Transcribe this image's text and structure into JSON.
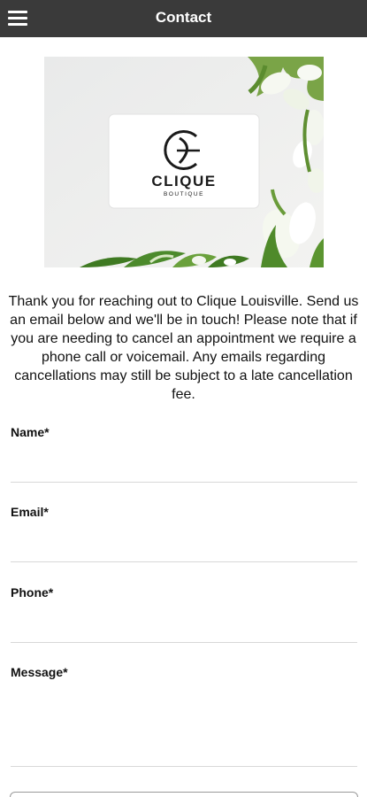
{
  "header": {
    "title": "Contact"
  },
  "hero": {
    "brand_name": "CLIQUE",
    "brand_sub": "BOUTIQUE",
    "monogram": "C"
  },
  "intro": {
    "text": "Thank you for reaching out to Clique Louisville. Send us an email below and we'll be in touch! Please note that if you are needing to cancel an appointment we require a phone call or voicemail. Any emails regarding cancellations may still be subject to a late cancellation fee."
  },
  "form": {
    "name_label": "Name*",
    "name_value": "",
    "email_label": "Email*",
    "email_value": "",
    "phone_label": "Phone*",
    "phone_value": "",
    "message_label": "Message*",
    "message_value": ""
  },
  "colors": {
    "topbar": "#3a3a3a",
    "text": "#111111",
    "divider": "#d8d8d8",
    "leaf_green": "#4c8a2c",
    "petal": "#f4f7ee"
  }
}
